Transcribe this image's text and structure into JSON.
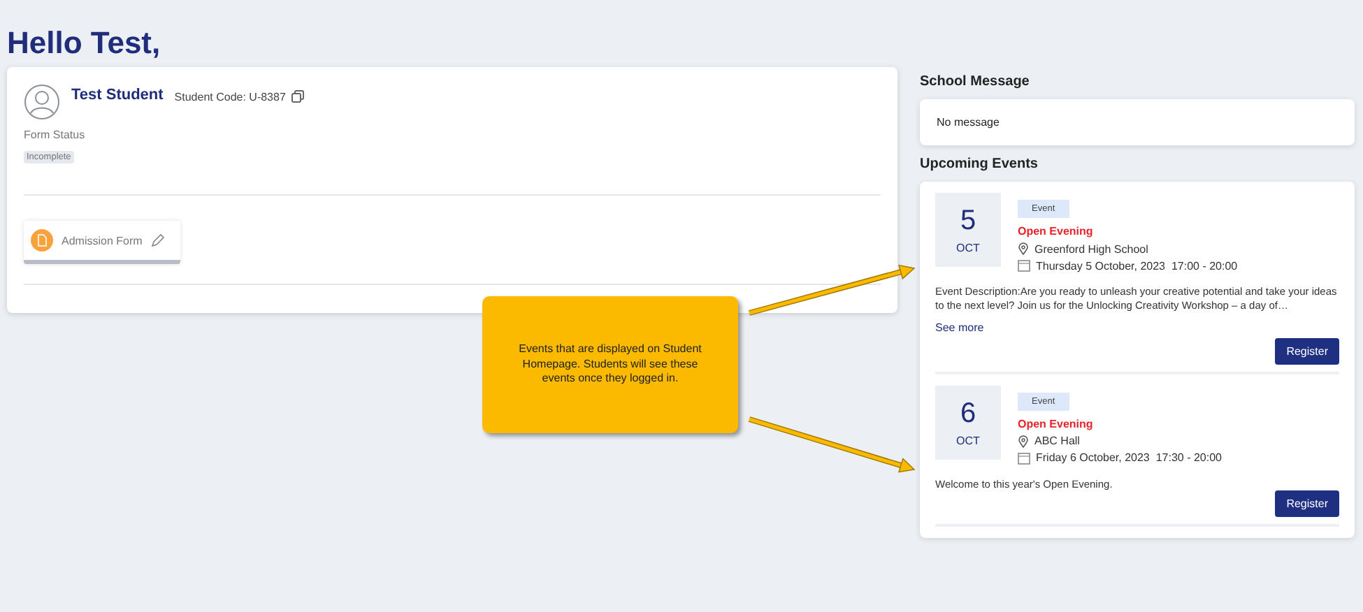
{
  "greeting": "Hello Test,",
  "student": {
    "name": "Test Student",
    "code": "Student Code: U-8387",
    "form_status_label": "Form Status",
    "form_status": "Incomplete",
    "forms": [
      {
        "label": "Admission Form"
      }
    ]
  },
  "school_message": {
    "title": "School Message",
    "text": "No message"
  },
  "upcoming_events": {
    "title": "Upcoming Events",
    "events": [
      {
        "day": "5",
        "month": "OCT",
        "tag": "Event",
        "title": "Open Evening",
        "location": "Greenford High School",
        "datetime": "Thursday 5 October, 2023  17:00 - 20:00",
        "description": "Event Description:Are you ready to unleash your creative potential and take your ideas to the next level? Join us for the Unlocking Creativity Workshop – a day of…",
        "see_more": "See more",
        "button": "Register"
      },
      {
        "day": "6",
        "month": "OCT",
        "tag": "Event",
        "title": "Open Evening",
        "location": "ABC Hall",
        "datetime": "Friday 6 October, 2023  17:30 - 20:00",
        "description": "Welcome to this year's Open Evening.",
        "button": "Register"
      }
    ]
  },
  "callout": {
    "text": "Events that are displayed on Student Homepage. Students will see these events once they logged in."
  }
}
